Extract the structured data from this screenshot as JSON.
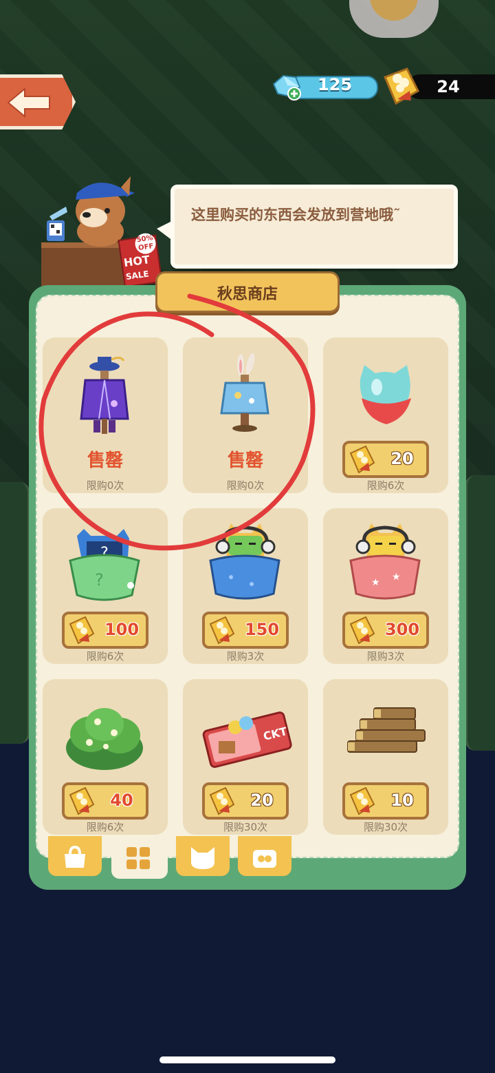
{
  "currency": {
    "gems": "125",
    "coins": "24"
  },
  "speech": {
    "text": "这里购买的东西会发放到营地哦˜"
  },
  "shop": {
    "title": "秋思商店",
    "items": [
      {
        "name": "purple-robe-outfit",
        "sold_out_label": "售罄",
        "limit": "限购0次"
      },
      {
        "name": "bunny-kimono-outfit",
        "sold_out_label": "售罄",
        "limit": "限购0次"
      },
      {
        "name": "cat-gem-egg",
        "price": "20",
        "limit": "限购6次"
      },
      {
        "name": "green-mystery-bag",
        "price": "100",
        "limit": "限购6次"
      },
      {
        "name": "blue-robot-bag",
        "price": "150",
        "limit": "限购3次"
      },
      {
        "name": "pink-robot-bag",
        "price": "300",
        "limit": "限购3次"
      },
      {
        "name": "flower-bush",
        "price": "40",
        "limit": "限购6次"
      },
      {
        "name": "ckt-ticket",
        "price": "20",
        "limit": "限购30次"
      },
      {
        "name": "wood-logs",
        "price": "10",
        "limit": "限购30次"
      }
    ]
  },
  "shop_sign": {
    "off": "50% OFF",
    "hot": "HOT",
    "sale": "SALE"
  },
  "tabs": [
    {
      "name": "bag-tab",
      "active": false
    },
    {
      "name": "grid-tab",
      "active": true
    },
    {
      "name": "cat-tab",
      "active": false
    },
    {
      "name": "popcorn-tab",
      "active": false
    }
  ],
  "colors": {
    "panel_green": "#5da877",
    "card_bg": "#ecdcba",
    "sold_out_red": "#e2542f",
    "annotation_red": "#e23b3b"
  }
}
